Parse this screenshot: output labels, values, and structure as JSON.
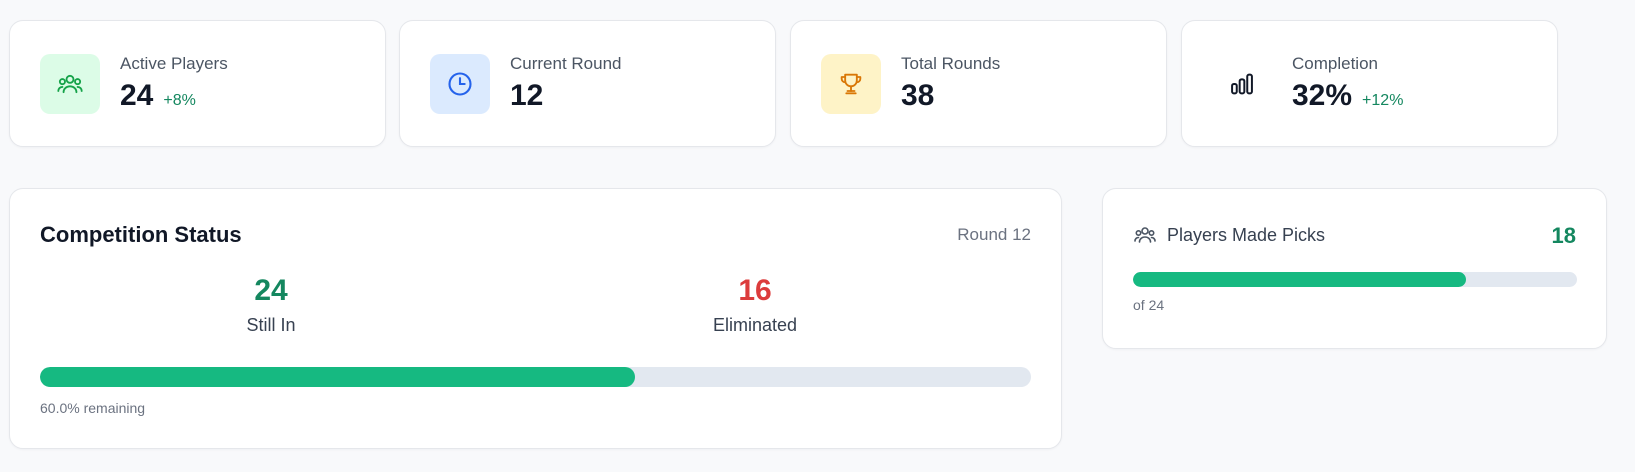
{
  "stats": [
    {
      "label": "Active Players",
      "value": "24",
      "delta": "+8%",
      "icon": "users-icon",
      "bg": "#dcfce7",
      "color": "#16a34a"
    },
    {
      "label": "Current Round",
      "value": "12",
      "delta": "",
      "icon": "clock-icon",
      "bg": "#dbeafe",
      "color": "#2563eb"
    },
    {
      "label": "Total Rounds",
      "value": "38",
      "delta": "",
      "icon": "trophy-icon",
      "bg": "#fef3c7",
      "color": "#d97706"
    },
    {
      "label": "Completion",
      "value": "32%",
      "delta": "+12%",
      "icon": "bar-chart-icon",
      "bg": "#ffffff",
      "color": "#111827"
    }
  ],
  "competition": {
    "title": "Competition Status",
    "round": "Round 12",
    "still_in": "24",
    "still_in_label": "Still In",
    "eliminated": "16",
    "eliminated_label": "Eliminated",
    "remaining_fraction": 0.6,
    "remaining_text": "60.0% remaining",
    "colors": {
      "still_in": "#14875f",
      "eliminated": "#dc3c3c",
      "bar": "#16b981"
    }
  },
  "picks": {
    "title": "Players Made Picks",
    "count": "18",
    "total_text": "of 24",
    "fraction": 0.75
  }
}
